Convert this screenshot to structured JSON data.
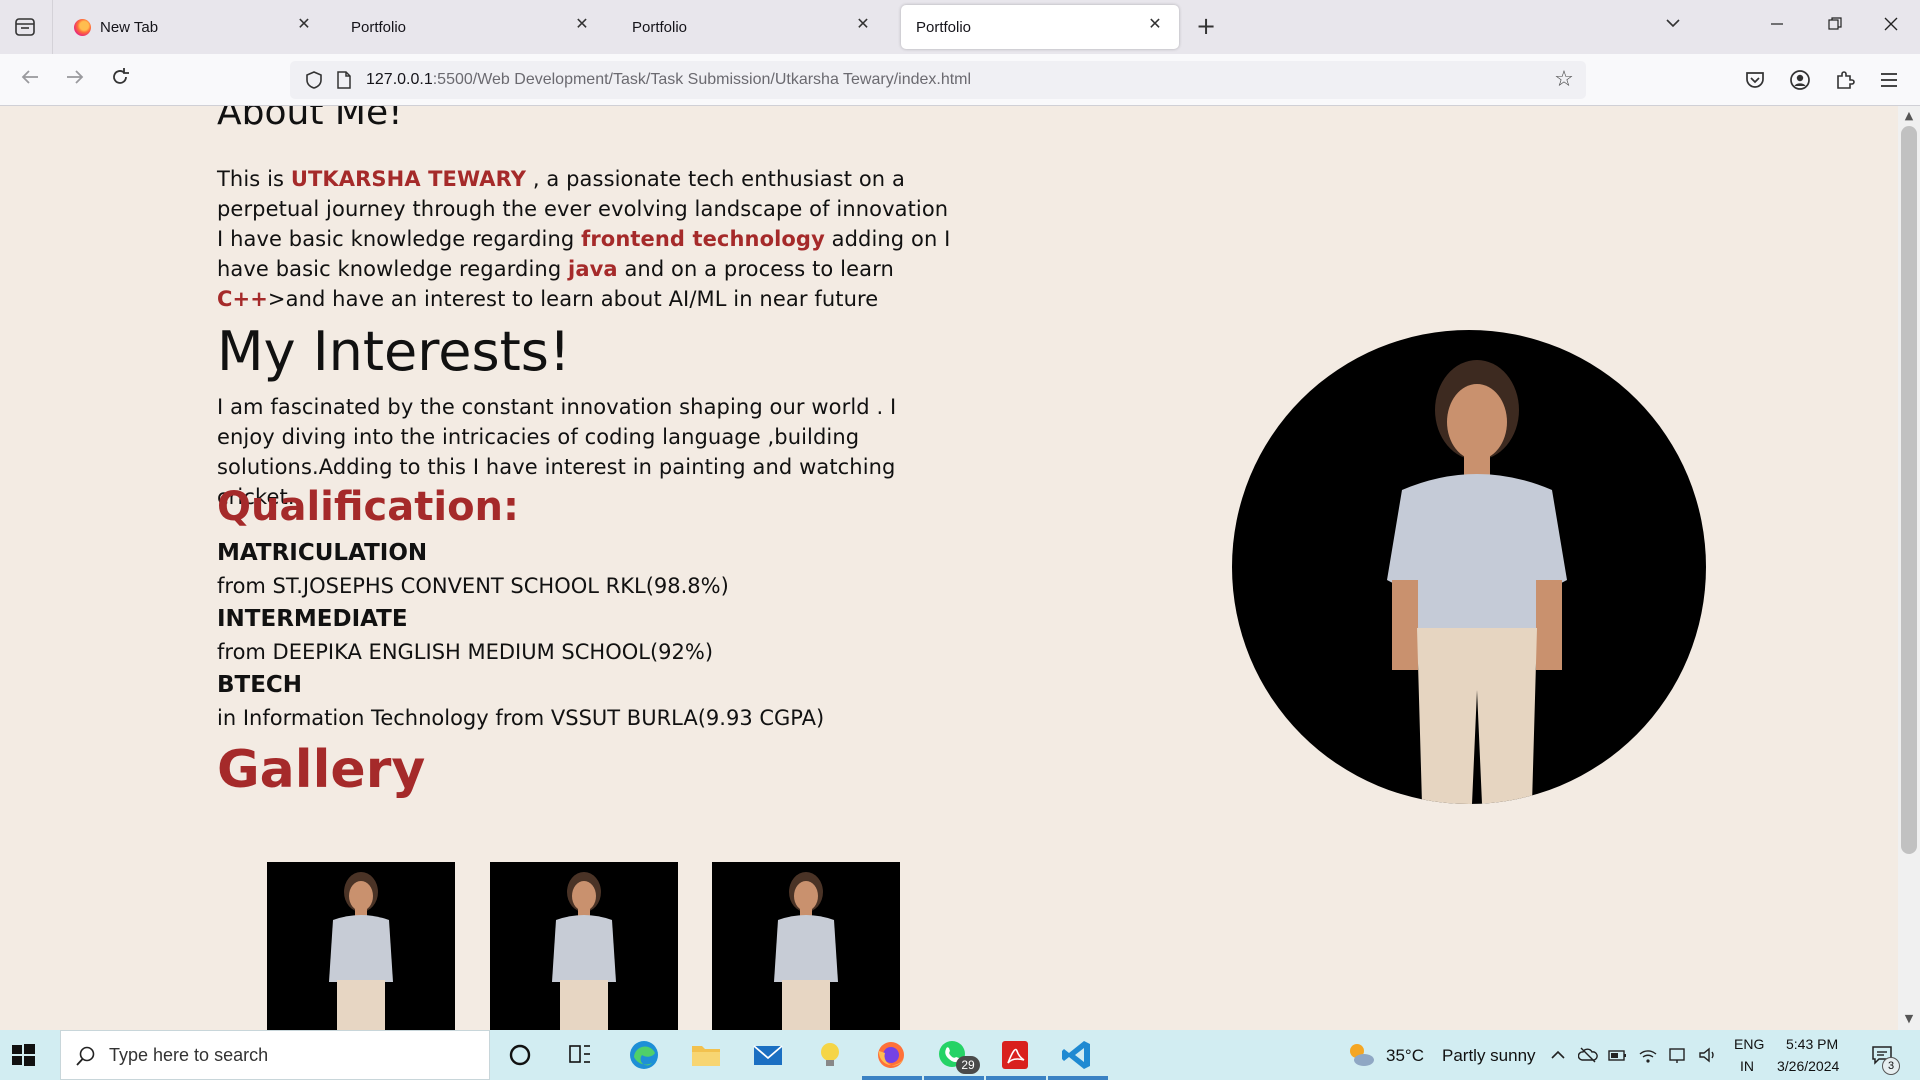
{
  "browser": {
    "tabs": [
      {
        "label": "New Tab",
        "active": false,
        "favicon": "firefox-icon"
      },
      {
        "label": "Portfolio",
        "active": false
      },
      {
        "label": "Portfolio",
        "active": false
      },
      {
        "label": "Portfolio",
        "active": true
      }
    ],
    "close_glyph": "✕",
    "new_tab_glyph": "+",
    "url_host": "127.0.0.1",
    "url_path": ":5500/Web Development/Task/Task Submission/Utkarsha Tewary/index.html"
  },
  "page": {
    "about_heading": "About Me!",
    "about_p1": {
      "prefix": "This is ",
      "name": "UTKARSHA TEWARY",
      "suffix": " , a passionate tech enthusiast on a perpetual journey through the ever evolving landscape of innovation"
    },
    "about_p2": {
      "t1": "I have basic knowledge regarding ",
      "h1": "frontend technology",
      "t2": " adding on I have basic knowledge regarding ",
      "h2": "java",
      "t3": " and on a process to learn ",
      "h3": "C++",
      "t4": ">and have an interest to learn about AI/ML in near future"
    },
    "interests_heading": "My Interests!",
    "interests_text": "I am fascinated by the constant innovation shaping our world . I enjoy diving into the intricacies of coding language ,building solutions.Adding to this I have interest in painting and watching cricket.",
    "qualification_heading": "Qualification:",
    "qualifications": [
      {
        "title": "MATRICULATION",
        "detail": "from ST.JOSEPHS CONVENT SCHOOL RKL(98.8%)"
      },
      {
        "title": "INTERMEDIATE",
        "detail": "from DEEPIKA ENGLISH MEDIUM SCHOOL(92%)"
      },
      {
        "title": "BTECH",
        "detail": "in Information Technology from VSSUT BURLA(9.93 CGPA)"
      }
    ],
    "gallery_heading": "Gallery",
    "accent_color": "#a52a2a"
  },
  "taskbar": {
    "search_placeholder": "Type here to search",
    "whatsapp_badge": "29",
    "weather_temp": "35°C",
    "weather_desc": "Partly sunny",
    "lang_top": "ENG",
    "lang_bottom": "IN",
    "time": "5:43 PM",
    "date": "3/26/2024",
    "notification_count": "3"
  }
}
